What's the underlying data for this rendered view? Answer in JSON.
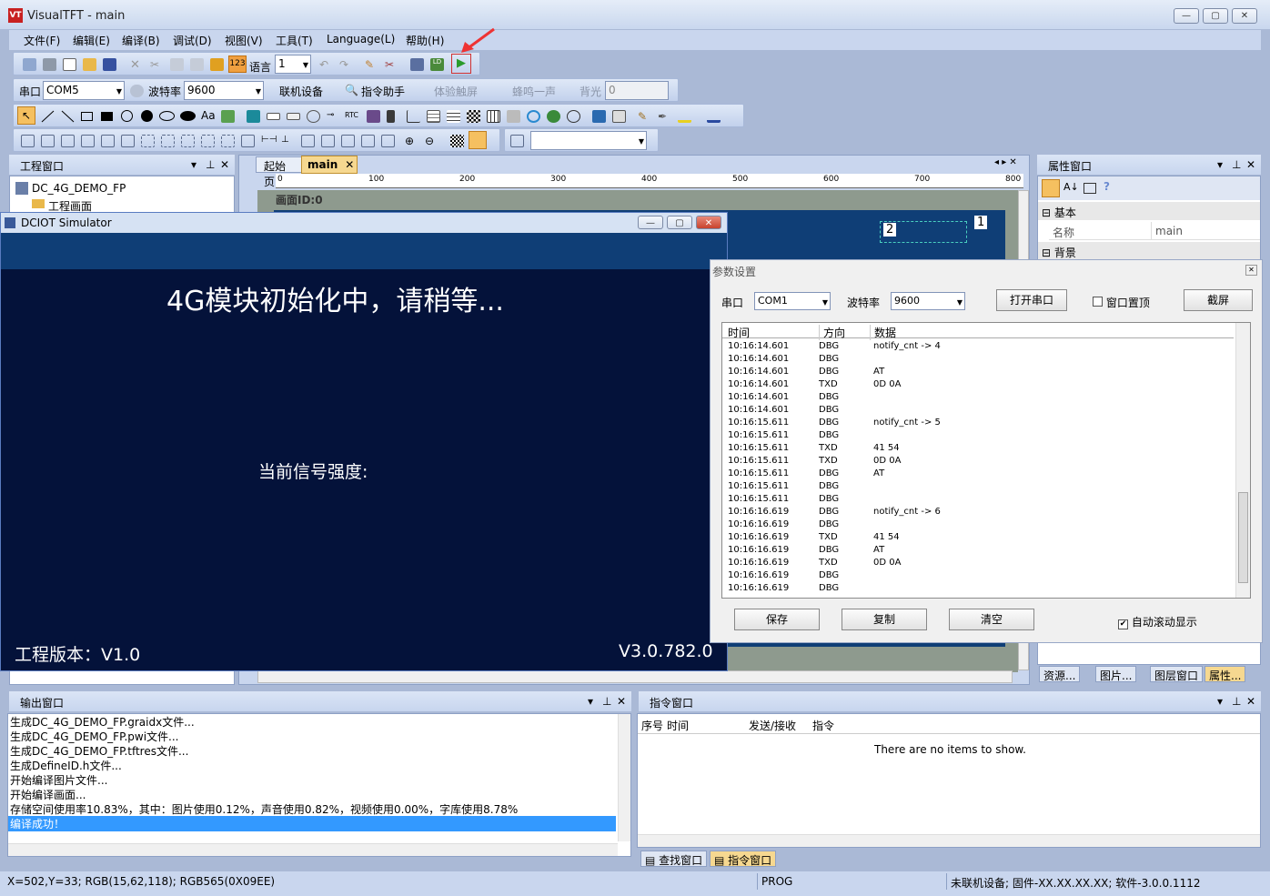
{
  "window": {
    "title": "VisualTFT - main"
  },
  "menu": [
    "文件(F)",
    "编辑(E)",
    "编译(B)",
    "调试(D)",
    "视图(V)",
    "工具(T)",
    "Language(L)",
    "帮助(H)"
  ],
  "toolbar1": {
    "language_label": "语言",
    "language_value": "1",
    "icon_123": "123"
  },
  "toolbar2": {
    "port_label": "串口",
    "port_value": "COM5",
    "baud_label": "波特率",
    "baud_value": "9600",
    "connect": "联机设备",
    "cmd_assistant": "指令助手",
    "touch": "体验触屏",
    "buzzer": "蜂鸣一声",
    "backlight_label": "背光",
    "backlight_value": "0"
  },
  "toolbar3": {
    "text_tool": "Aa",
    "rtc": "RTC"
  },
  "project_panel": {
    "title": "工程窗口",
    "root": "DC_4G_DEMO_FP",
    "child": "工程画面"
  },
  "editor": {
    "tabs": [
      "起始页",
      "main"
    ],
    "ruler": [
      "0",
      "100",
      "200",
      "300",
      "400",
      "500",
      "600",
      "700",
      "800"
    ],
    "screen_id": "画面ID:0",
    "marker1": "1",
    "marker2": "2"
  },
  "simulator": {
    "title": "DCIOT Simulator",
    "init_text": "4G模块初始化中，请稍等...",
    "signal_label": "当前信号强度:",
    "project_version": "工程版本：V1.0",
    "version": "V3.0.782.0"
  },
  "properties_panel": {
    "title": "属性窗口",
    "group_basic": "基本",
    "name_label": "名称",
    "name_value": "main",
    "group_bg": "背景",
    "tabs": [
      "资源...",
      "图片...",
      "图层窗口",
      "属性..."
    ]
  },
  "param_dialog": {
    "title": "参数设置",
    "port_label": "串口",
    "port_value": "COM1",
    "baud_label": "波特率",
    "baud_value": "9600",
    "open_port": "打开串口",
    "topmost": "窗口置顶",
    "screenshot": "截屏",
    "columns": [
      "时间",
      "方向",
      "数据"
    ],
    "rows": [
      [
        "10:16:14.601",
        "DBG",
        "notify_cnt -> 4"
      ],
      [
        "10:16:14.601",
        "DBG",
        ""
      ],
      [
        "10:16:14.601",
        "DBG",
        "AT"
      ],
      [
        "10:16:14.601",
        "TXD",
        "0D 0A"
      ],
      [
        "10:16:14.601",
        "DBG",
        ""
      ],
      [
        "10:16:14.601",
        "DBG",
        ""
      ],
      [
        "10:16:15.611",
        "DBG",
        "notify_cnt -> 5"
      ],
      [
        "10:16:15.611",
        "DBG",
        ""
      ],
      [
        "10:16:15.611",
        "TXD",
        "41 54"
      ],
      [
        "10:16:15.611",
        "TXD",
        "0D 0A"
      ],
      [
        "10:16:15.611",
        "DBG",
        "AT"
      ],
      [
        "10:16:15.611",
        "DBG",
        ""
      ],
      [
        "10:16:15.611",
        "DBG",
        ""
      ],
      [
        "10:16:16.619",
        "DBG",
        "notify_cnt -> 6"
      ],
      [
        "10:16:16.619",
        "DBG",
        ""
      ],
      [
        "10:16:16.619",
        "TXD",
        "41 54"
      ],
      [
        "10:16:16.619",
        "DBG",
        "AT"
      ],
      [
        "10:16:16.619",
        "TXD",
        "0D 0A"
      ],
      [
        "10:16:16.619",
        "DBG",
        ""
      ],
      [
        "10:16:16.619",
        "DBG",
        ""
      ]
    ],
    "save": "保存",
    "copy": "复制",
    "clear": "清空",
    "autoscroll": "自动滚动显示"
  },
  "output_panel": {
    "title": "输出窗口",
    "lines": [
      "生成DC_4G_DEMO_FP.graidx文件...",
      "生成DC_4G_DEMO_FP.pwi文件...",
      "生成DC_4G_DEMO_FP.tftres文件...",
      "生成DefineID.h文件...",
      "开始编译图片文件...",
      "开始编译画面...",
      "存储空间使用率10.83%，其中：图片使用0.12%，声音使用0.82%，视频使用0.00%，字库使用8.78%",
      "编译成功！"
    ]
  },
  "command_panel": {
    "title": "指令窗口",
    "columns": [
      "序号",
      "时间",
      "发送/接收",
      "指令"
    ],
    "empty": "There are no items to show.",
    "tabs": [
      "查找窗口",
      "指令窗口"
    ]
  },
  "statusbar": {
    "coords": "X=502,Y=33; RGB(15,62,118); RGB565(0X09EE)",
    "mode": "PROG",
    "device": "未联机设备; 固件-XX.XX.XX.XX; 软件-3.0.0.1112"
  }
}
